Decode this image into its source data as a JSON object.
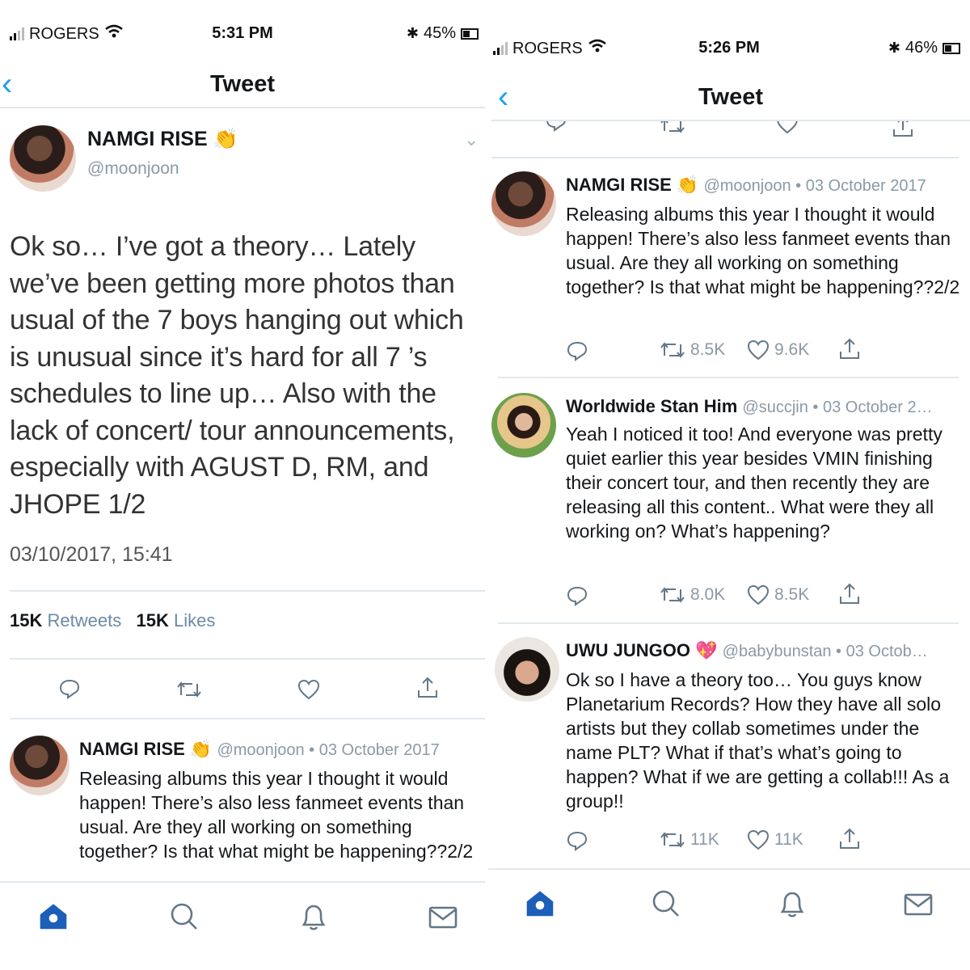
{
  "left": {
    "status": {
      "carrier": "ROGERS",
      "time": "5:31 PM",
      "battery": "45%"
    },
    "nav": {
      "title": "Tweet"
    },
    "main_tweet": {
      "name": "NAMGI RISE",
      "emoji": "👏",
      "handle": "@moonjoon",
      "text": "Ok so… I’ve got a theory… Lately we’ve been getting more photos than usual of the 7 boys hanging out which is unusual since it’s hard for all 7 ’s schedules to line up… Also with the lack of concert/ tour announcements, especially with AGUST D, RM, and JHOPE 1/2",
      "timestamp": "03/10/2017, 15:41",
      "retweets_count": "15K",
      "retweets_label": "Retweets",
      "likes_count": "15K",
      "likes_label": "Likes"
    },
    "reply": {
      "name": "NAMGI RISE",
      "emoji": "👏",
      "meta": "@moonjoon • 03 October 2017",
      "text": "Releasing albums this year I thought it would happen! There’s also less fanmeet events than usual. Are they all working on something together? Is that what might be happening??2/2"
    }
  },
  "right": {
    "status": {
      "carrier": "ROGERS",
      "time": "5:26 PM",
      "battery": "46%"
    },
    "nav": {
      "title": "Tweet"
    },
    "tweets": [
      {
        "name": "NAMGI RISE",
        "emoji": "👏",
        "meta": "@moonjoon • 03 October 2017",
        "text": "Releasing albums this year I thought it would happen! There’s also less fanmeet events than usual. Are they all working on something together? Is that what might be happening??2/2",
        "retweets": "8.5K",
        "likes": "9.6K"
      },
      {
        "name": "Worldwide Stan Him",
        "emoji": "",
        "meta": "@succjin • 03 October 2…",
        "text": "Yeah I noticed it too! And everyone was pretty quiet earlier this year besides VMIN finishing their concert tour, and then recently they are releasing all this content.. What were they all working on? What’s happening?",
        "retweets": "8.0K",
        "likes": "8.5K"
      },
      {
        "name": "UWU JUNGOO",
        "emoji": "💖",
        "meta": "@babybunstan • 03 Octob…",
        "text": "Ok so I have a theory too… You guys know Planetarium Records? How they have all solo artists but they collab sometimes under the name PLT? What if that’s what’s going to happen? What if we are getting a collab!!! As a group!!",
        "retweets": "11K",
        "likes": "11K"
      }
    ]
  },
  "colors": {
    "accent": "#1da1f2",
    "active_tab": "#1c5fb8",
    "muted": "#8a9aa6",
    "divider": "#e1e8ed"
  },
  "icons": [
    "back-chevron-icon",
    "reply-icon",
    "retweet-icon",
    "like-icon",
    "share-icon",
    "home-icon",
    "search-icon",
    "notifications-icon",
    "messages-icon"
  ]
}
